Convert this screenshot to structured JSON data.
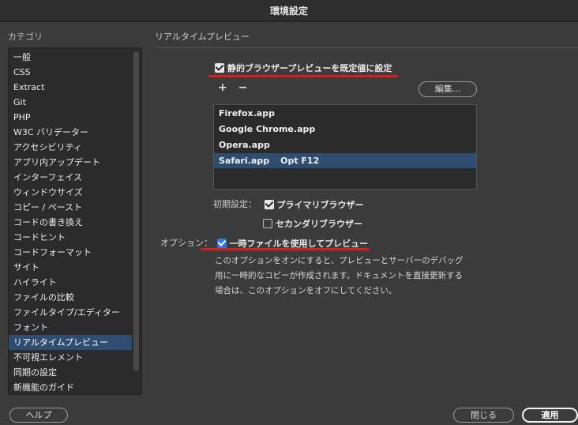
{
  "window": {
    "title": "環境設定"
  },
  "sidebar": {
    "header": "カテゴリ",
    "items": [
      {
        "label": "一般"
      },
      {
        "label": "CSS"
      },
      {
        "label": "Extract"
      },
      {
        "label": "Git"
      },
      {
        "label": "PHP"
      },
      {
        "label": "W3C バリデーター"
      },
      {
        "label": "アクセシビリティ"
      },
      {
        "label": "アプリ内アップデート"
      },
      {
        "label": "インターフェイス"
      },
      {
        "label": "ウィンドウサイズ"
      },
      {
        "label": "コピー / ペースト"
      },
      {
        "label": "コードの書き換え"
      },
      {
        "label": "コードヒント"
      },
      {
        "label": "コードフォーマット"
      },
      {
        "label": "サイト"
      },
      {
        "label": "ハイライト"
      },
      {
        "label": "ファイルの比較"
      },
      {
        "label": "ファイルタイプ/エディター"
      },
      {
        "label": "フォント"
      },
      {
        "label": "リアルタイムプレビュー"
      },
      {
        "label": "不可視エレメント"
      },
      {
        "label": "同期の設定"
      },
      {
        "label": "新機能のガイド"
      }
    ],
    "selected": "リアルタイムプレビュー"
  },
  "panel": {
    "title": "リアルタイムプレビュー",
    "static_preview_checkbox": {
      "label": "静的ブラウザープレビューを既定値に設定",
      "checked": true
    },
    "add_label": "+",
    "remove_label": "−",
    "edit_button": "編集...",
    "browsers": [
      {
        "name": "Firefox.app",
        "shortcut": ""
      },
      {
        "name": "Google Chrome.app",
        "shortcut": ""
      },
      {
        "name": "Opera.app",
        "shortcut": ""
      },
      {
        "name": "Safari.app",
        "shortcut": "Opt F12"
      }
    ],
    "defaults_label": "初期設定：",
    "primary_browser": {
      "label": "プライマリブラウザー",
      "checked": true
    },
    "secondary_browser": {
      "label": "セカンダリブラウザー",
      "checked": false
    },
    "options_label": "オプション：",
    "temp_file_checkbox": {
      "label": "一時ファイルを使用してプレビュー",
      "checked": true
    },
    "description": "このオプションをオンにすると、プレビューとサーバーのデバッグ用に一時的なコピーが作成されます。ドキュメントを直接更新する場合は、このオプションをオフにしてください。"
  },
  "footer": {
    "help_button": "ヘルプ",
    "close_button": "閉じる",
    "apply_button": "適用"
  },
  "colors": {
    "background": "#3b3b3b",
    "selection": "#2f4d70",
    "annotation_red": "#d41f1f",
    "checkbox_blue": "#2f7ae0"
  }
}
